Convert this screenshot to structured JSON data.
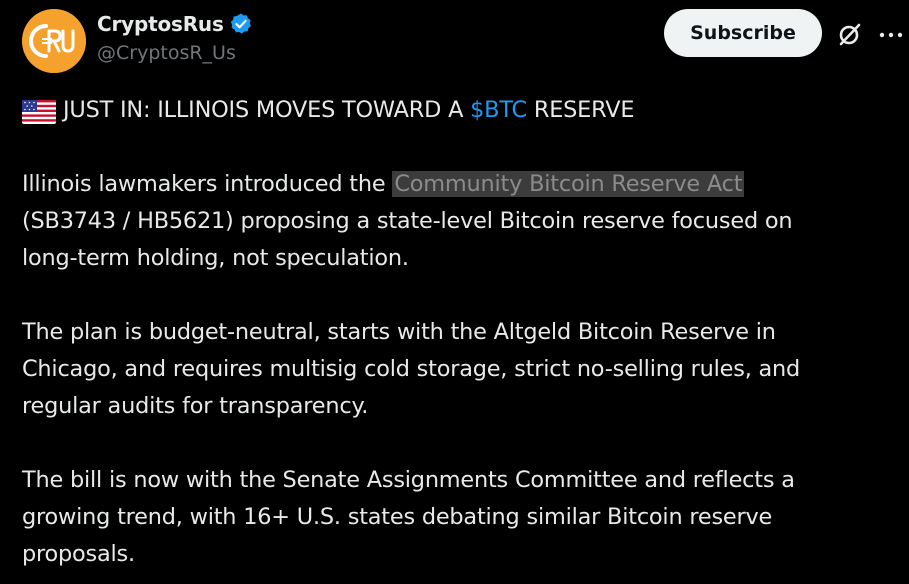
{
  "colors": {
    "background": "#000000",
    "text": "#e7e9ea",
    "muted": "#71767b",
    "link": "#1d9bf0",
    "avatar_bg": "#f5a12e",
    "verified": "#1d9bf0",
    "subscribe_bg": "#eff3f4"
  },
  "author": {
    "display_name": "CryptosRus",
    "handle": "@CryptosR_Us",
    "verified_icon": "verified-badge-icon",
    "avatar_icon": "crypto-rus-logo"
  },
  "actions": {
    "subscribe_label": "Subscribe",
    "grok_icon": "grok-slash-circle-icon",
    "more_icon": "more-dots-icon"
  },
  "tweet": {
    "headline_flag": "us-flag-icon",
    "headline_pre": "JUST IN: ILLINOIS MOVES TOWARD A ",
    "headline_cashtag": "$BTC",
    "headline_post": " RESERVE",
    "p1_pre": "Illinois lawmakers introduced the ",
    "p1_highlight": "Community Bitcoin Reserve Act",
    "p1_line2": "(SB3743 / HB5621) proposing a state-level Bitcoin reserve focused on",
    "p1_line3": "long-term holding, not speculation.",
    "p2_line1": "The plan is budget-neutral, starts with the Altgeld Bitcoin Reserve in",
    "p2_line2": "Chicago, and requires multisig cold storage, strict no-selling rules, and",
    "p2_line3": "regular audits for transparency.",
    "p3_line1": "The bill is now with the Senate Assignments Committee and reflects a",
    "p3_line2": "growing trend, with 16+ U.S. states debating similar Bitcoin reserve",
    "p3_line3": "proposals."
  }
}
